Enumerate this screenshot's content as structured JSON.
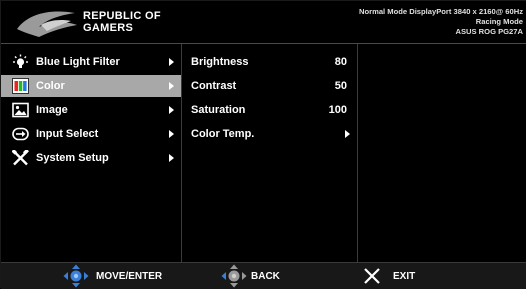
{
  "header": {
    "brand_line1": "REPUBLIC OF",
    "brand_line2": "GAMERS",
    "info_line1": "Normal Mode DisplayPort 3840 x 2160@ 60Hz",
    "info_line2": "Racing Mode",
    "info_line3": "ASUS ROG PG27A"
  },
  "main_menu": {
    "selected_index": 1,
    "items": [
      {
        "label": "Blue Light Filter",
        "icon": "bulb-icon"
      },
      {
        "label": "Color",
        "icon": "color-palette-icon"
      },
      {
        "label": "Image",
        "icon": "image-icon"
      },
      {
        "label": "Input Select",
        "icon": "input-select-icon"
      },
      {
        "label": "System Setup",
        "icon": "tools-icon"
      }
    ]
  },
  "submenu": {
    "items": [
      {
        "label": "Brightness",
        "value": "80"
      },
      {
        "label": "Contrast",
        "value": "50"
      },
      {
        "label": "Saturation",
        "value": "100"
      },
      {
        "label": "Color Temp.",
        "value": ""
      }
    ]
  },
  "footer": {
    "move_enter": "MOVE/ENTER",
    "back": "BACK",
    "exit": "EXIT"
  },
  "colors": {
    "selected_bg": "#a8a8a8",
    "dpad_blue": "#3b7fd6",
    "exit_x": "#ffffff"
  }
}
